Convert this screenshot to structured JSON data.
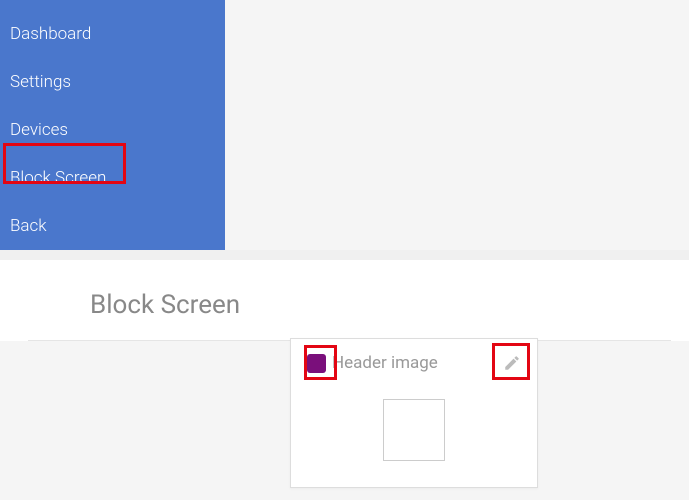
{
  "sidebar": {
    "items": [
      {
        "label": "Dashboard"
      },
      {
        "label": "Settings"
      },
      {
        "label": "Devices"
      },
      {
        "label": "Block Screen"
      },
      {
        "label": "Back"
      }
    ]
  },
  "page": {
    "title": "Block Screen"
  },
  "card": {
    "title": "Header image",
    "swatch_color": "#7a0f7b"
  }
}
